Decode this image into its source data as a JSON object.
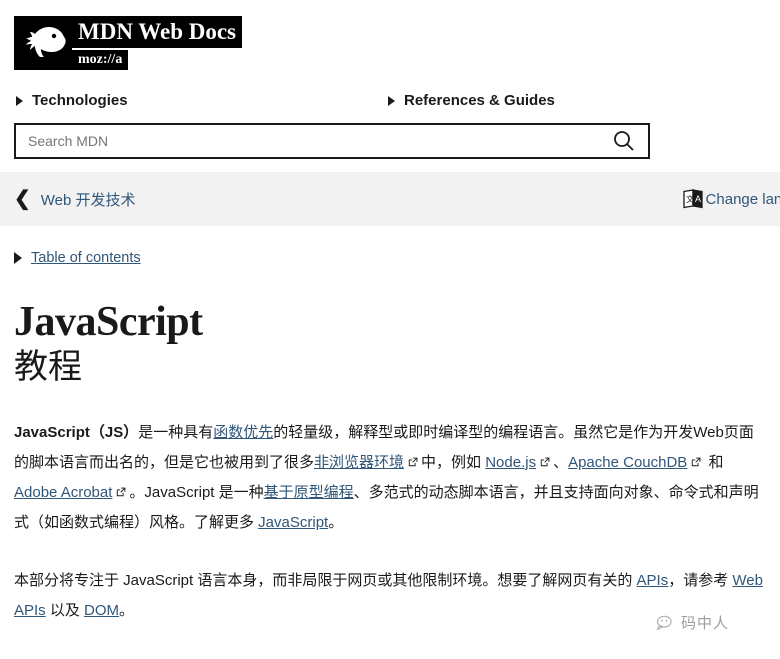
{
  "site": {
    "logo_title": "MDN Web Docs",
    "logo_sub": "moz://a",
    "logo_icon": "dino-head-icon"
  },
  "nav": {
    "items": [
      {
        "label": "Technologies",
        "icon": "caret-right-icon"
      },
      {
        "label": "References & Guides",
        "icon": "caret-right-icon"
      }
    ]
  },
  "search": {
    "placeholder": "Search MDN",
    "value": "",
    "button_icon": "search-icon"
  },
  "breadcrumb": {
    "back_icon": "chevron-left-icon",
    "parent": "Web 开发技术",
    "language_icon": "translate-icon",
    "language_label": "Change language"
  },
  "toc": {
    "icon": "caret-right-icon",
    "label": "Table of contents"
  },
  "article": {
    "title": "JavaScript",
    "subtitle": "教程",
    "paragraph1": {
      "lead_bold": "JavaScript（JS）",
      "t1": "是一种具有",
      "link1": "函数优先",
      "t2": "的轻量级，解释型或即时编译型的编程语言。虽然它是作为开发Web页面的脚本语言而出名的，但是它也被用到了很多",
      "link2": "非浏览器环境",
      "t3": "中，例如 ",
      "link3": "Node.js",
      "t4": "、",
      "link4": "Apache CouchDB",
      "t5": " 和 ",
      "link5": "Adobe Acrobat",
      "t6": "。JavaScript 是一种",
      "link6": "基于原型编程",
      "t7": "、多范式的动态脚本语言，并且支持面向对象、命令式和声明式（如函数式编程）风格。了解更多 ",
      "link7": "JavaScript",
      "t8": "。"
    },
    "paragraph2": {
      "t1": "本部分将专注于 JavaScript 语言本身，而非局限于网页或其他限制环境。想要了解网页有关的 ",
      "link1": "APIs",
      "t2": "，请参考 ",
      "link2": "Web APIs",
      "t3": " 以及 ",
      "link3": "DOM",
      "t4": "。"
    }
  },
  "watermark": {
    "icon": "wechat-icon",
    "text": "码中人"
  },
  "colors": {
    "link": "#30567a",
    "text": "#1a1a1a",
    "bar_bg": "#f2f2f2",
    "logo_bg": "#000000"
  }
}
